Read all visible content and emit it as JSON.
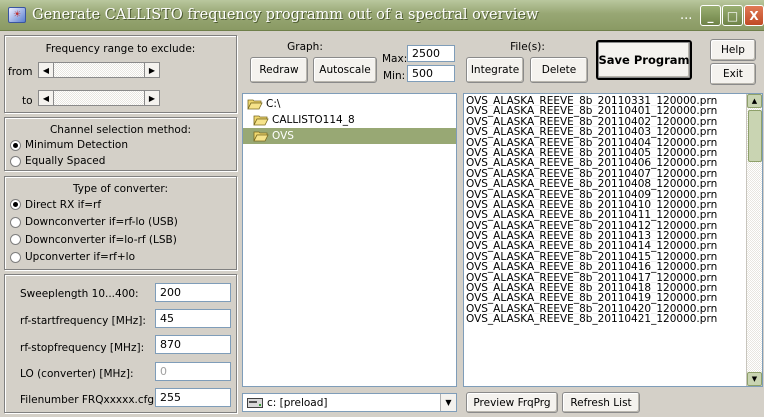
{
  "window": {
    "title": "Generate CALLISTO frequency programm out of a spectral overview",
    "title_dots": "...",
    "min_glyph": "_",
    "max_glyph": "□",
    "close_glyph": "X",
    "icon_glyph": "☀"
  },
  "freq_exclude": {
    "title": "Frequency range to exclude:",
    "from_label": "from",
    "to_label": "to"
  },
  "graph": {
    "title": "Graph:",
    "redraw_label": "Redraw",
    "autoscale_label": "Autoscale",
    "max_label": "Max:",
    "max_value": "2500",
    "min_label": "Min:",
    "min_value": "500"
  },
  "files": {
    "title": "File(s):",
    "integrate_label": "Integrate",
    "delete_label": "Delete"
  },
  "toolbar": {
    "save_label": "Save Program",
    "help_label": "Help",
    "exit_label": "Exit"
  },
  "channel": {
    "title": "Channel selection method:",
    "options": [
      "Minimum Detection",
      "Equally Spaced"
    ],
    "selected_index": 0
  },
  "converter": {
    "title": "Type of converter:",
    "options": [
      "Direct RX if=rf",
      "Downconverter if=rf-lo (USB)",
      "Downconverter if=lo-rf (LSB)",
      "Upconverter if=rf+lo"
    ],
    "selected_index": 0
  },
  "params": [
    {
      "label": "Sweeplength 10...400:",
      "value": "200",
      "disabled": false
    },
    {
      "label": "rf-startfrequency [MHz]:",
      "value": "45",
      "disabled": false
    },
    {
      "label": "rf-stopfrequency [MHz]:",
      "value": "870",
      "disabled": false
    },
    {
      "label": "LO (converter) [MHz]:",
      "value": "0",
      "disabled": true
    },
    {
      "label": "Filenumber FRQxxxxx.cfg:",
      "value": "255",
      "disabled": false
    }
  ],
  "folders": [
    {
      "name": "C:\\",
      "selected": false,
      "indent": 0
    },
    {
      "name": "CALLISTO114_8",
      "selected": false,
      "indent": 1
    },
    {
      "name": "OVS",
      "selected": true,
      "indent": 1
    }
  ],
  "drive": {
    "value": "c: [preload]"
  },
  "files_list": [
    "OVS_ALASKA_REEVE_8b_20110331_120000.prn",
    "OVS_ALASKA_REEVE_8b_20110401_120000.prn",
    "OVS_ALASKA_REEVE_8b_20110402_120000.prn",
    "OVS_ALASKA_REEVE_8b_20110403_120000.prn",
    "OVS_ALASKA_REEVE_8b_20110404_120000.prn",
    "OVS_ALASKA_REEVE_8b_20110405_120000.prn",
    "OVS_ALASKA_REEVE_8b_20110406_120000.prn",
    "OVS_ALASKA_REEVE_8b_20110407_120000.prn",
    "OVS_ALASKA_REEVE_8b_20110408_120000.prn",
    "OVS_ALASKA_REEVE_8b_20110409_120000.prn",
    "OVS_ALASKA_REEVE_8b_20110410_120000.prn",
    "OVS_ALASKA_REEVE_8b_20110411_120000.prn",
    "OVS_ALASKA_REEVE_8b_20110412_120000.prn",
    "OVS_ALASKA_REEVE_8b_20110413_120000.prn",
    "OVS_ALASKA_REEVE_8b_20110414_120000.prn",
    "OVS_ALASKA_REEVE_8b_20110415_120000.prn",
    "OVS_ALASKA_REEVE_8b_20110416_120000.prn",
    "OVS_ALASKA_REEVE_8b_20110417_120000.prn",
    "OVS_ALASKA_REEVE_8b_20110418_120000.prn",
    "OVS_ALASKA_REEVE_8b_20110419_120000.prn",
    "OVS_ALASKA_REEVE_8b_20110420_120000.prn",
    "OVS_ALASKA_REEVE_8b_20110421_120000.prn"
  ],
  "bottom": {
    "preview_label": "Preview FrqPrg",
    "refresh_label": "Refresh List"
  },
  "colors": {
    "titlebar": "#98a774",
    "folder_selected": "#98a874",
    "close_button": "#c04a25"
  }
}
